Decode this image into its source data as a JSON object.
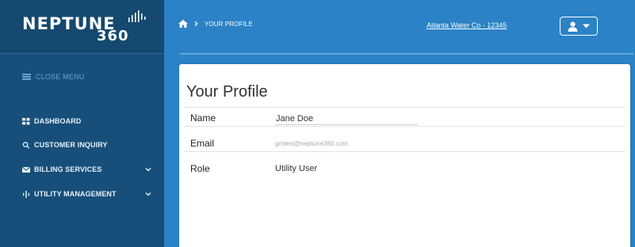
{
  "brand": {
    "name": "NEPTUNE",
    "sub": "360"
  },
  "sidebar": {
    "close_menu_label": "CLOSE MENU",
    "items": [
      {
        "label": "DASHBOARD",
        "icon": "grid-icon",
        "has_chevron": false
      },
      {
        "label": "CUSTOMER INQUIRY",
        "icon": "search-icon",
        "has_chevron": false
      },
      {
        "label": "BILLING SERVICES",
        "icon": "envelope-icon",
        "has_chevron": true
      },
      {
        "label": "UTILITY MANAGEMENT",
        "icon": "meter-icon",
        "has_chevron": true
      }
    ]
  },
  "header": {
    "breadcrumb_home_icon": "home-icon",
    "breadcrumb_separator_icon": "chevron-right-icon",
    "breadcrumb_current": "YOUR PROFILE",
    "account_link": "Atlanta Water Co - 12345",
    "user_icon": "user-icon",
    "dropdown_icon": "caret-down-icon"
  },
  "profile": {
    "title": "Your Profile",
    "fields": [
      {
        "label": "Name",
        "value": "Jane Doe"
      },
      {
        "label": "Email",
        "value": "gmtest@neptune360.com"
      },
      {
        "label": "Role",
        "value": "Utility User"
      }
    ]
  },
  "colors": {
    "sidebar_bg": "#174f7a",
    "header_bg": "#2b82c6",
    "card_bg": "#ffffff"
  }
}
